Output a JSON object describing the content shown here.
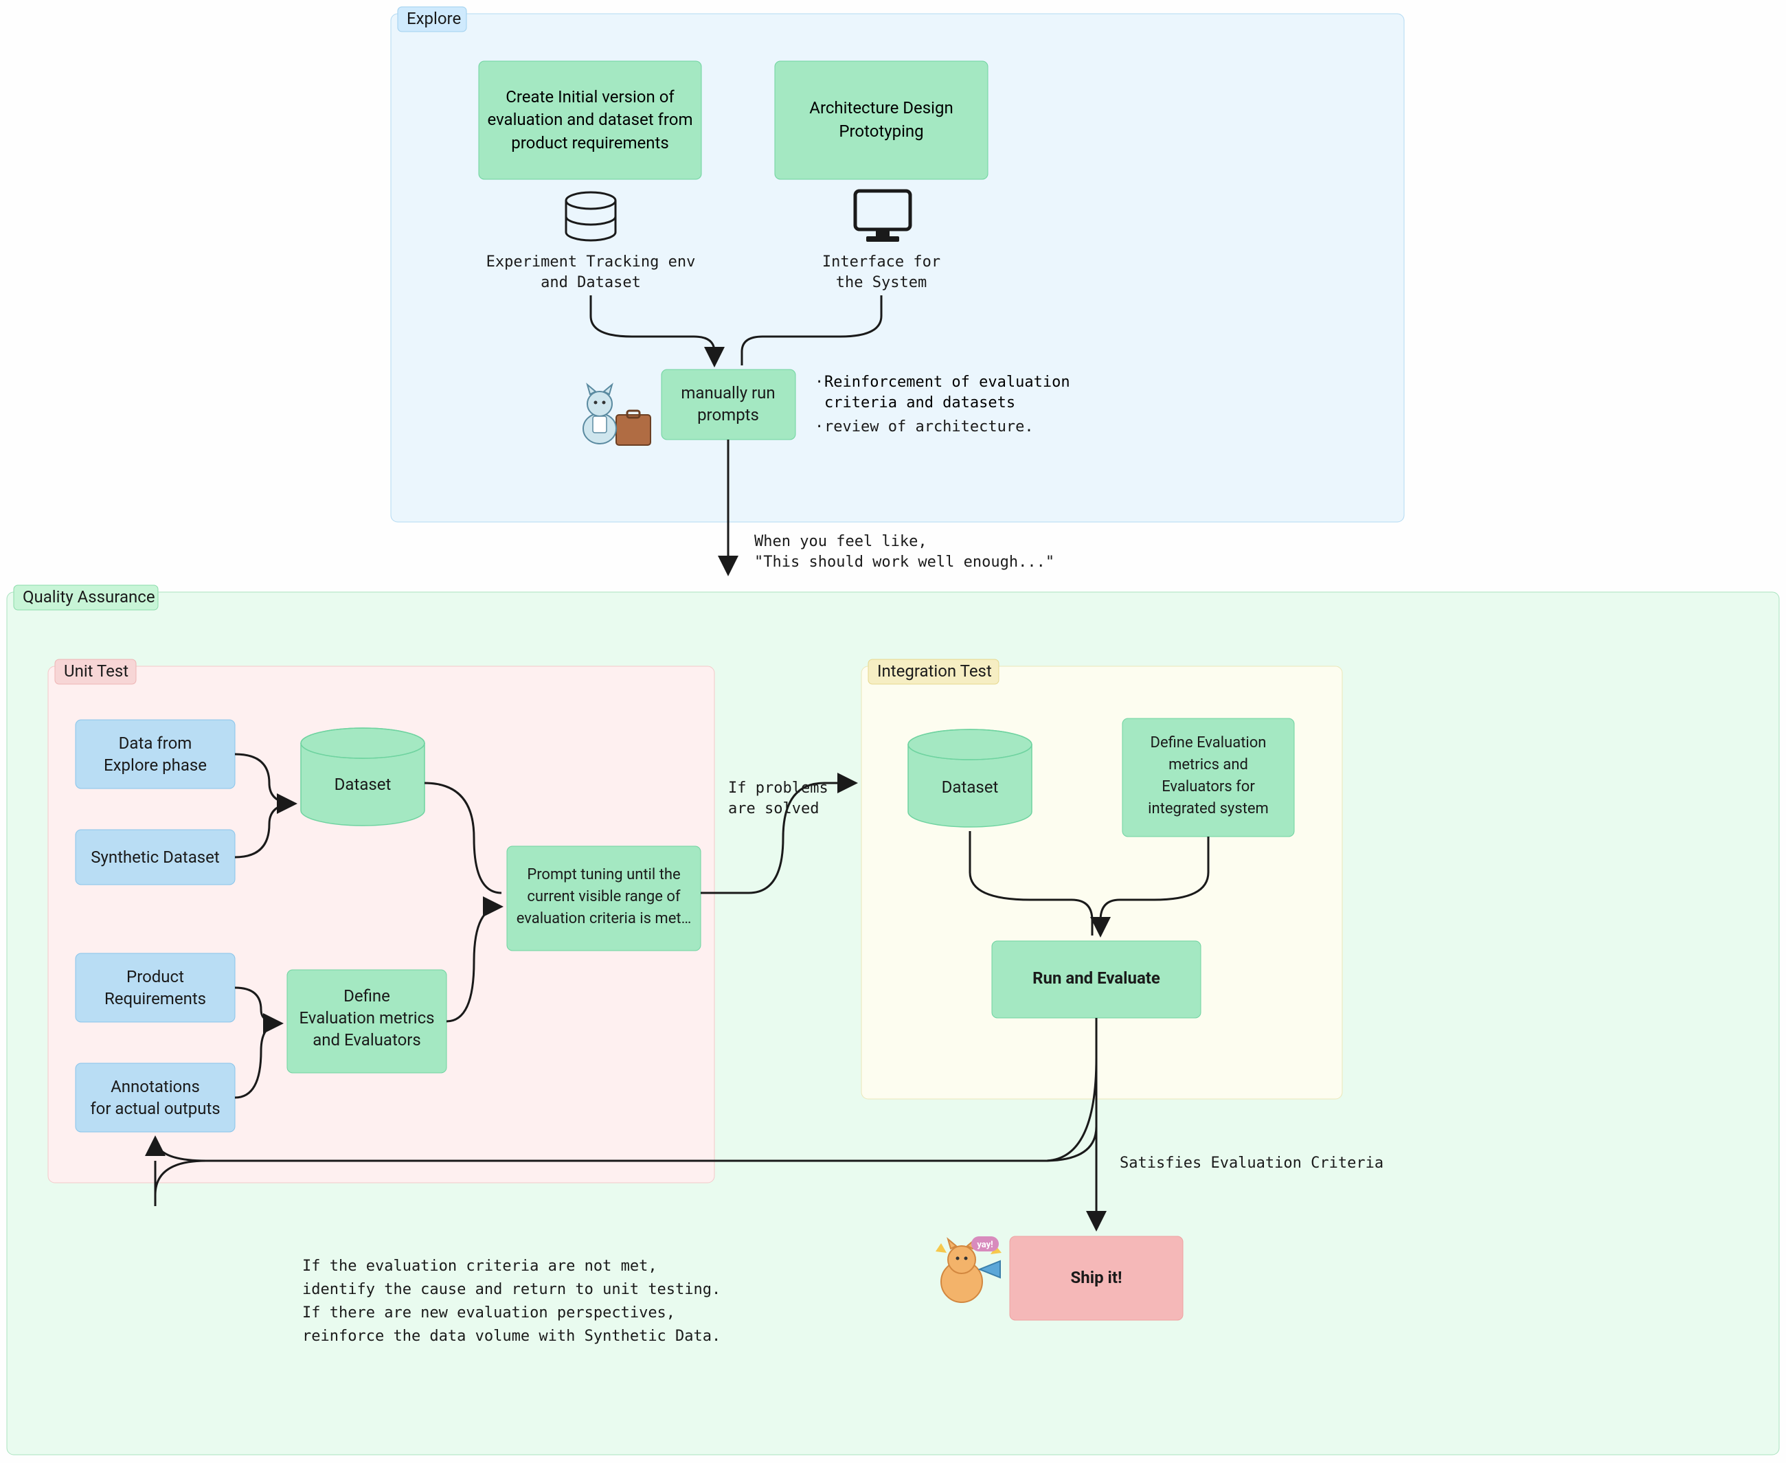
{
  "regions": {
    "explore": "Explore",
    "qa": "Quality Assurance",
    "unit": "Unit Test",
    "integration": "Integration Test"
  },
  "explore": {
    "create_initial": "Create Initial version of evaluation and dataset from product requirements",
    "arch_design": "Architecture Design Prototyping",
    "tracking_env_l1": "Experiment Tracking env",
    "tracking_env_l2": "and Dataset",
    "interface_l1": "Interface for",
    "interface_l2": "the System",
    "manually_run_l1": "manually run",
    "manually_run_l2": "prompts",
    "bullet1": "Reinforcement of evaluation criteria and datasets",
    "bullet2": "review of architecture.",
    "transition_l1": "When you feel like,",
    "transition_l2": "\"This should work well enough...\""
  },
  "unit": {
    "data_from_l1": "Data from",
    "data_from_l2": "Explore phase",
    "synthetic": "Synthetic Dataset",
    "product_req_l1": "Product",
    "product_req_l2": "Requirements",
    "annotations_l1": "Annotations",
    "annotations_l2": "for actual outputs",
    "dataset": "Dataset",
    "define_l1": "Define",
    "define_l2": "Evaluation metrics",
    "define_l3": "and Evaluators",
    "prompt_tuning_l1": "Prompt tuning until the",
    "prompt_tuning_l2": "current visible range of",
    "prompt_tuning_l3": "evaluation criteria is met…",
    "if_solved_l1": "If problems",
    "if_solved_l2": "are solved"
  },
  "integration": {
    "dataset": "Dataset",
    "define_l1": "Define Evaluation",
    "define_l2": "metrics and",
    "define_l3": "Evaluators for",
    "define_l4": "integrated system",
    "run_eval": "Run and Evaluate",
    "satisfies": "Satisfies Evaluation Criteria",
    "ship": "Ship it!"
  },
  "feedback": {
    "l1": "If the evaluation criteria are not met,",
    "l2": "identify the cause and return to unit testing.",
    "l3": "If there are new evaluation perspectives,",
    "l4": "reinforce the data volume with Synthetic Data."
  }
}
